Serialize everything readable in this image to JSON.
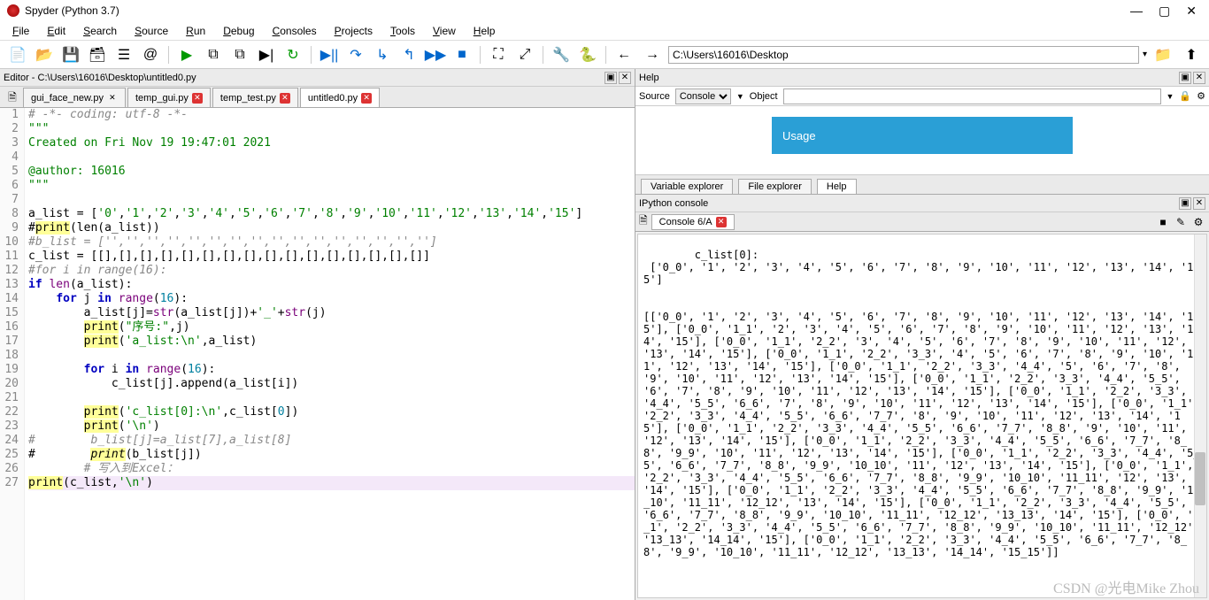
{
  "title": "Spyder (Python 3.7)",
  "menu": [
    "File",
    "Edit",
    "Search",
    "Source",
    "Run",
    "Debug",
    "Consoles",
    "Projects",
    "Tools",
    "View",
    "Help"
  ],
  "editor_header": "Editor - C:\\Users\\16016\\Desktop\\untitled0.py",
  "path_input": "C:\\Users\\16016\\Desktop",
  "file_tabs": [
    {
      "name": "gui_face_new.py",
      "dirty": false,
      "active": false
    },
    {
      "name": "temp_gui.py",
      "dirty": true,
      "active": false
    },
    {
      "name": "temp_test.py",
      "dirty": true,
      "active": false
    },
    {
      "name": "untitled0.py",
      "dirty": true,
      "active": true
    }
  ],
  "code_lines": [
    {
      "n": 1,
      "cls": "c-comment",
      "txt": "# -*- coding: utf-8 -*-"
    },
    {
      "n": 2,
      "cls": "c-str",
      "txt": "\"\"\""
    },
    {
      "n": 3,
      "cls": "c-str",
      "txt": "Created on Fri Nov 19 19:47:01 2021"
    },
    {
      "n": 4,
      "cls": "",
      "txt": ""
    },
    {
      "n": 5,
      "cls": "c-str",
      "txt": "@author: 16016"
    },
    {
      "n": 6,
      "cls": "c-str",
      "txt": "\"\"\""
    },
    {
      "n": 7,
      "cls": "",
      "txt": ""
    },
    {
      "n": 8,
      "html": "a_list = [<span class='c-str'>'0'</span>,<span class='c-str'>'1'</span>,<span class='c-str'>'2'</span>,<span class='c-str'>'3'</span>,<span class='c-str'>'4'</span>,<span class='c-str'>'5'</span>,<span class='c-str'>'6'</span>,<span class='c-str'>'7'</span>,<span class='c-str'>'8'</span>,<span class='c-str'>'9'</span>,<span class='c-str'>'10'</span>,<span class='c-str'>'11'</span>,<span class='c-str'>'12'</span>,<span class='c-str'>'13'</span>,<span class='c-str'>'14'</span>,<span class='c-str'>'15'</span>]"
    },
    {
      "n": 9,
      "cls": "c-comment",
      "html": "#<span class='c-print'>print</span>(len(a_list))"
    },
    {
      "n": 10,
      "cls": "c-comment",
      "txt": "#b_list = ['','','','','','','','','','','','','','','','']"
    },
    {
      "n": 11,
      "html": "c_list = [[],[],[],[],[],[],[],[],[],[],[],[],[],[],[],[]]"
    },
    {
      "n": 12,
      "cls": "c-comment",
      "txt": "#for i in range(16):"
    },
    {
      "n": 13,
      "html": "<span class='c-kw'>if</span> <span class='c-fn'>len</span>(a_list):"
    },
    {
      "n": 14,
      "html": "    <span class='c-kw'>for</span> j <span class='c-kw'>in</span> <span class='c-fn'>range</span>(<span class='c-num'>16</span>):"
    },
    {
      "n": 15,
      "html": "        a_list[j]=<span class='c-fn'>str</span>(a_list[j])+<span class='c-str'>'_'</span>+<span class='c-fn'>str</span>(j)"
    },
    {
      "n": 16,
      "html": "        <span class='c-print'>print</span>(<span class='c-str'>\"序号:\"</span>,j)"
    },
    {
      "n": 17,
      "html": "        <span class='c-print'>print</span>(<span class='c-str'>'a_list:\\n'</span>,a_list)"
    },
    {
      "n": 18,
      "cls": "",
      "txt": ""
    },
    {
      "n": 19,
      "html": "        <span class='c-kw'>for</span> i <span class='c-kw'>in</span> <span class='c-fn'>range</span>(<span class='c-num'>16</span>):"
    },
    {
      "n": 20,
      "html": "            c_list[j].append(a_list[i])"
    },
    {
      "n": 21,
      "cls": "",
      "txt": ""
    },
    {
      "n": 22,
      "html": "        <span class='c-print'>print</span>(<span class='c-str'>'c_list[0]:\\n'</span>,c_list[<span class='c-num'>0</span>])"
    },
    {
      "n": 23,
      "html": "        <span class='c-print'>print</span>(<span class='c-str'>'\\n'</span>)"
    },
    {
      "n": 24,
      "cls": "c-comment",
      "txt": "#        b_list[j]=a_list[7],a_list[8]"
    },
    {
      "n": 25,
      "cls": "c-comment",
      "html": "#        <span class='c-print' style='font-style:italic'>print</span>(b_list[j])"
    },
    {
      "n": 26,
      "cls": "c-comment",
      "txt": "        # 写入到Excel："
    },
    {
      "n": 27,
      "cur": true,
      "html": "<span class='c-print'>print</span>(c_list,<span class='c-str'>'\\n'</span>)"
    }
  ],
  "help_pane_title": "Help",
  "help_source_label": "Source",
  "help_source_value": "Console",
  "help_object_label": "Object",
  "help_usage": "Usage",
  "help_tabs": [
    "Variable explorer",
    "File explorer",
    "Help"
  ],
  "help_active_tab": "Help",
  "ipython_title": "IPython console",
  "console_tab": "Console 6/A",
  "console_output": "c_list[0]:\n ['0_0', '1', '2', '3', '4', '5', '6', '7', '8', '9', '10', '11', '12', '13', '14', '15']\n\n\n[['0_0', '1', '2', '3', '4', '5', '6', '7', '8', '9', '10', '11', '12', '13', '14', '15'], ['0_0', '1_1', '2', '3', '4', '5', '6', '7', '8', '9', '10', '11', '12', '13', '14', '15'], ['0_0', '1_1', '2_2', '3', '4', '5', '6', '7', '8', '9', '10', '11', '12', '13', '14', '15'], ['0_0', '1_1', '2_2', '3_3', '4', '5', '6', '7', '8', '9', '10', '11', '12', '13', '14', '15'], ['0_0', '1_1', '2_2', '3_3', '4_4', '5', '6', '7', '8', '9', '10', '11', '12', '13', '14', '15'], ['0_0', '1_1', '2_2', '3_3', '4_4', '5_5', '6', '7', '8', '9', '10', '11', '12', '13', '14', '15'], ['0_0', '1_1', '2_2', '3_3', '4_4', '5_5', '6_6', '7', '8', '9', '10', '11', '12', '13', '14', '15'], ['0_0', '1_1', '2_2', '3_3', '4_4', '5_5', '6_6', '7_7', '8', '9', '10', '11', '12', '13', '14', '15'], ['0_0', '1_1', '2_2', '3_3', '4_4', '5_5', '6_6', '7_7', '8_8', '9', '10', '11', '12', '13', '14', '15'], ['0_0', '1_1', '2_2', '3_3', '4_4', '5_5', '6_6', '7_7', '8_8', '9_9', '10', '11', '12', '13', '14', '15'], ['0_0', '1_1', '2_2', '3_3', '4_4', '5_5', '6_6', '7_7', '8_8', '9_9', '10_10', '11', '12', '13', '14', '15'], ['0_0', '1_1', '2_2', '3_3', '4_4', '5_5', '6_6', '7_7', '8_8', '9_9', '10_10', '11_11', '12', '13', '14', '15'], ['0_0', '1_1', '2_2', '3_3', '4_4', '5_5', '6_6', '7_7', '8_8', '9_9', '10_10', '11_11', '12_12', '13', '14', '15'], ['0_0', '1_1', '2_2', '3_3', '4_4', '5_5', '6_6', '7_7', '8_8', '9_9', '10_10', '11_11', '12_12', '13_13', '14', '15'], ['0_0', '1_1', '2_2', '3_3', '4_4', '5_5', '6_6', '7_7', '8_8', '9_9', '10_10', '11_11', '12_12', '13_13', '14_14', '15'], ['0_0', '1_1', '2_2', '3_3', '4_4', '5_5', '6_6', '7_7', '8_8', '9_9', '10_10', '11_11', '12_12', '13_13', '14_14', '15_15']]",
  "watermark": "CSDN @光电Mike Zhou"
}
